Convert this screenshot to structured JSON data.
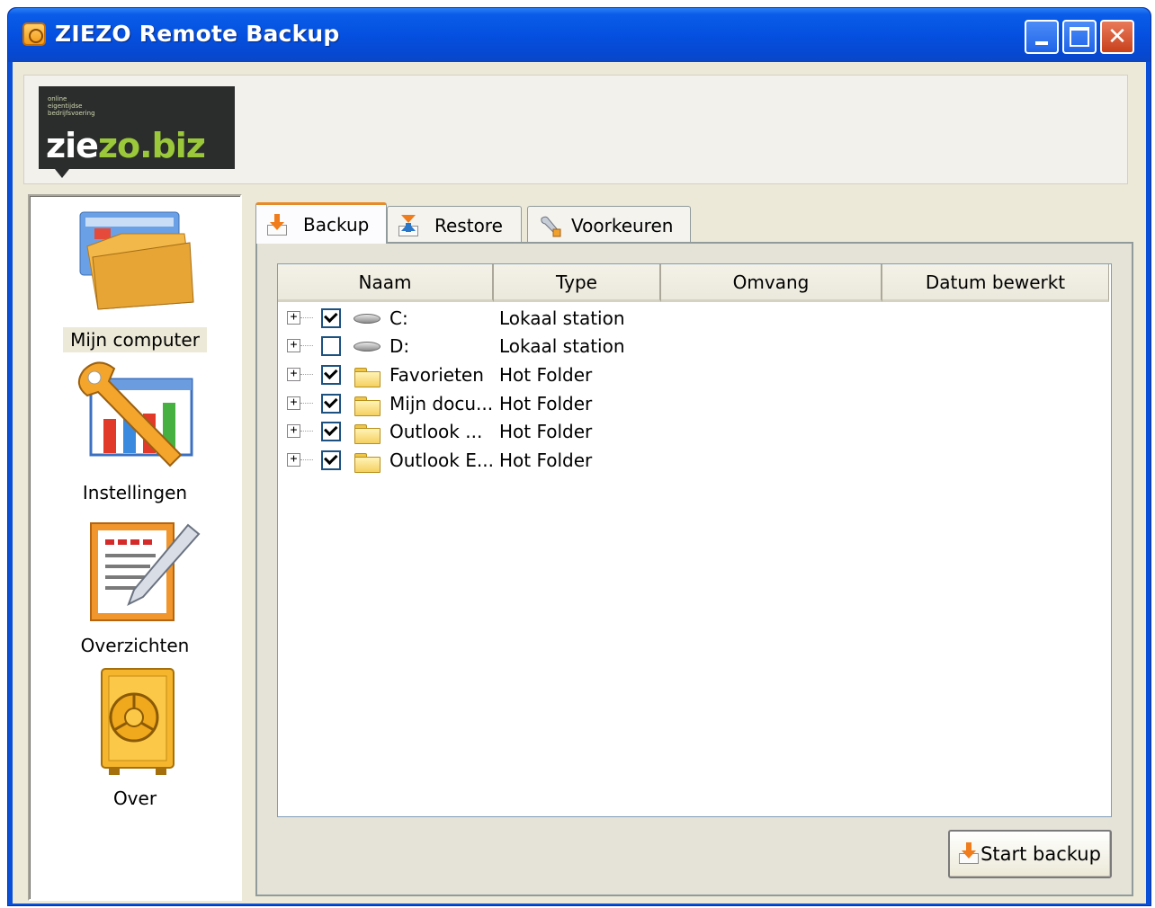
{
  "window": {
    "title": "ZIEZO Remote Backup",
    "title_color": "#0a5ce8"
  },
  "logo": {
    "tagline": [
      "online",
      "eigentijdse",
      "bedrijfsvoering"
    ],
    "brand_part1": "zie",
    "brand_part2": "zo.biz",
    "accent_color": "#9ac83a"
  },
  "sidebar": {
    "items": [
      {
        "label": "Mijn computer",
        "icon": "folder-computer-icon",
        "selected": true
      },
      {
        "label": "Instellingen",
        "icon": "wrench-chart-icon",
        "selected": false
      },
      {
        "label": "Overzichten",
        "icon": "report-pencil-icon",
        "selected": false
      },
      {
        "label": "Over",
        "icon": "safe-icon",
        "selected": false
      }
    ]
  },
  "tabs": [
    {
      "label": "Backup",
      "icon": "download-arrow-icon",
      "active": true
    },
    {
      "label": "Restore",
      "icon": "upload-arrow-icon",
      "active": false
    },
    {
      "label": "Voorkeuren",
      "icon": "wrench-icon",
      "active": false
    }
  ],
  "table": {
    "columns": [
      "Naam",
      "Type",
      "Omvang",
      "Datum bewerkt"
    ],
    "rows": [
      {
        "name": "C:",
        "type": "Lokaal station",
        "checked": true,
        "icon": "drive-icon"
      },
      {
        "name": "D:",
        "type": "Lokaal station",
        "checked": false,
        "icon": "drive-icon"
      },
      {
        "name": "Favorieten",
        "type": "Hot Folder",
        "checked": true,
        "icon": "folder-icon"
      },
      {
        "name": "Mijn docu...",
        "type": "Hot Folder",
        "checked": true,
        "icon": "folder-icon"
      },
      {
        "name": "Outlook ...",
        "type": "Hot Folder",
        "checked": true,
        "icon": "folder-icon"
      },
      {
        "name": "Outlook E...",
        "type": "Hot Folder",
        "checked": true,
        "icon": "folder-icon"
      }
    ]
  },
  "actions": {
    "start_backup_label": "Start backup"
  }
}
